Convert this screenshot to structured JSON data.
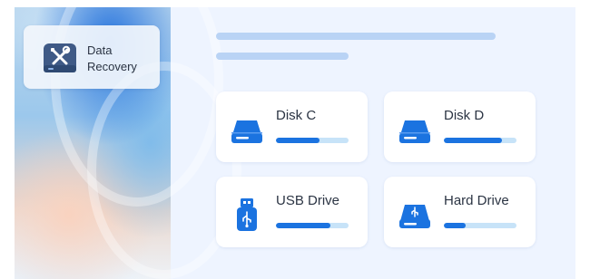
{
  "app": {
    "name": "Data Recovery",
    "icon": "data-recovery-tools-icon"
  },
  "colors": {
    "accent": "#1b73e0",
    "bar_track": "#c7e3f8",
    "panel_bg": "#eef4ff",
    "skeleton": "#b9d3f5"
  },
  "drives": [
    {
      "label": "Disk C",
      "icon": "disk-drive-icon",
      "usage": 0.6
    },
    {
      "label": "Disk D",
      "icon": "disk-drive-icon",
      "usage": 0.8
    },
    {
      "label": "USB Drive",
      "icon": "usb-drive-icon",
      "usage": 0.75
    },
    {
      "label": "Hard Drive",
      "icon": "external-hard-drive-icon",
      "usage": 0.3
    }
  ]
}
